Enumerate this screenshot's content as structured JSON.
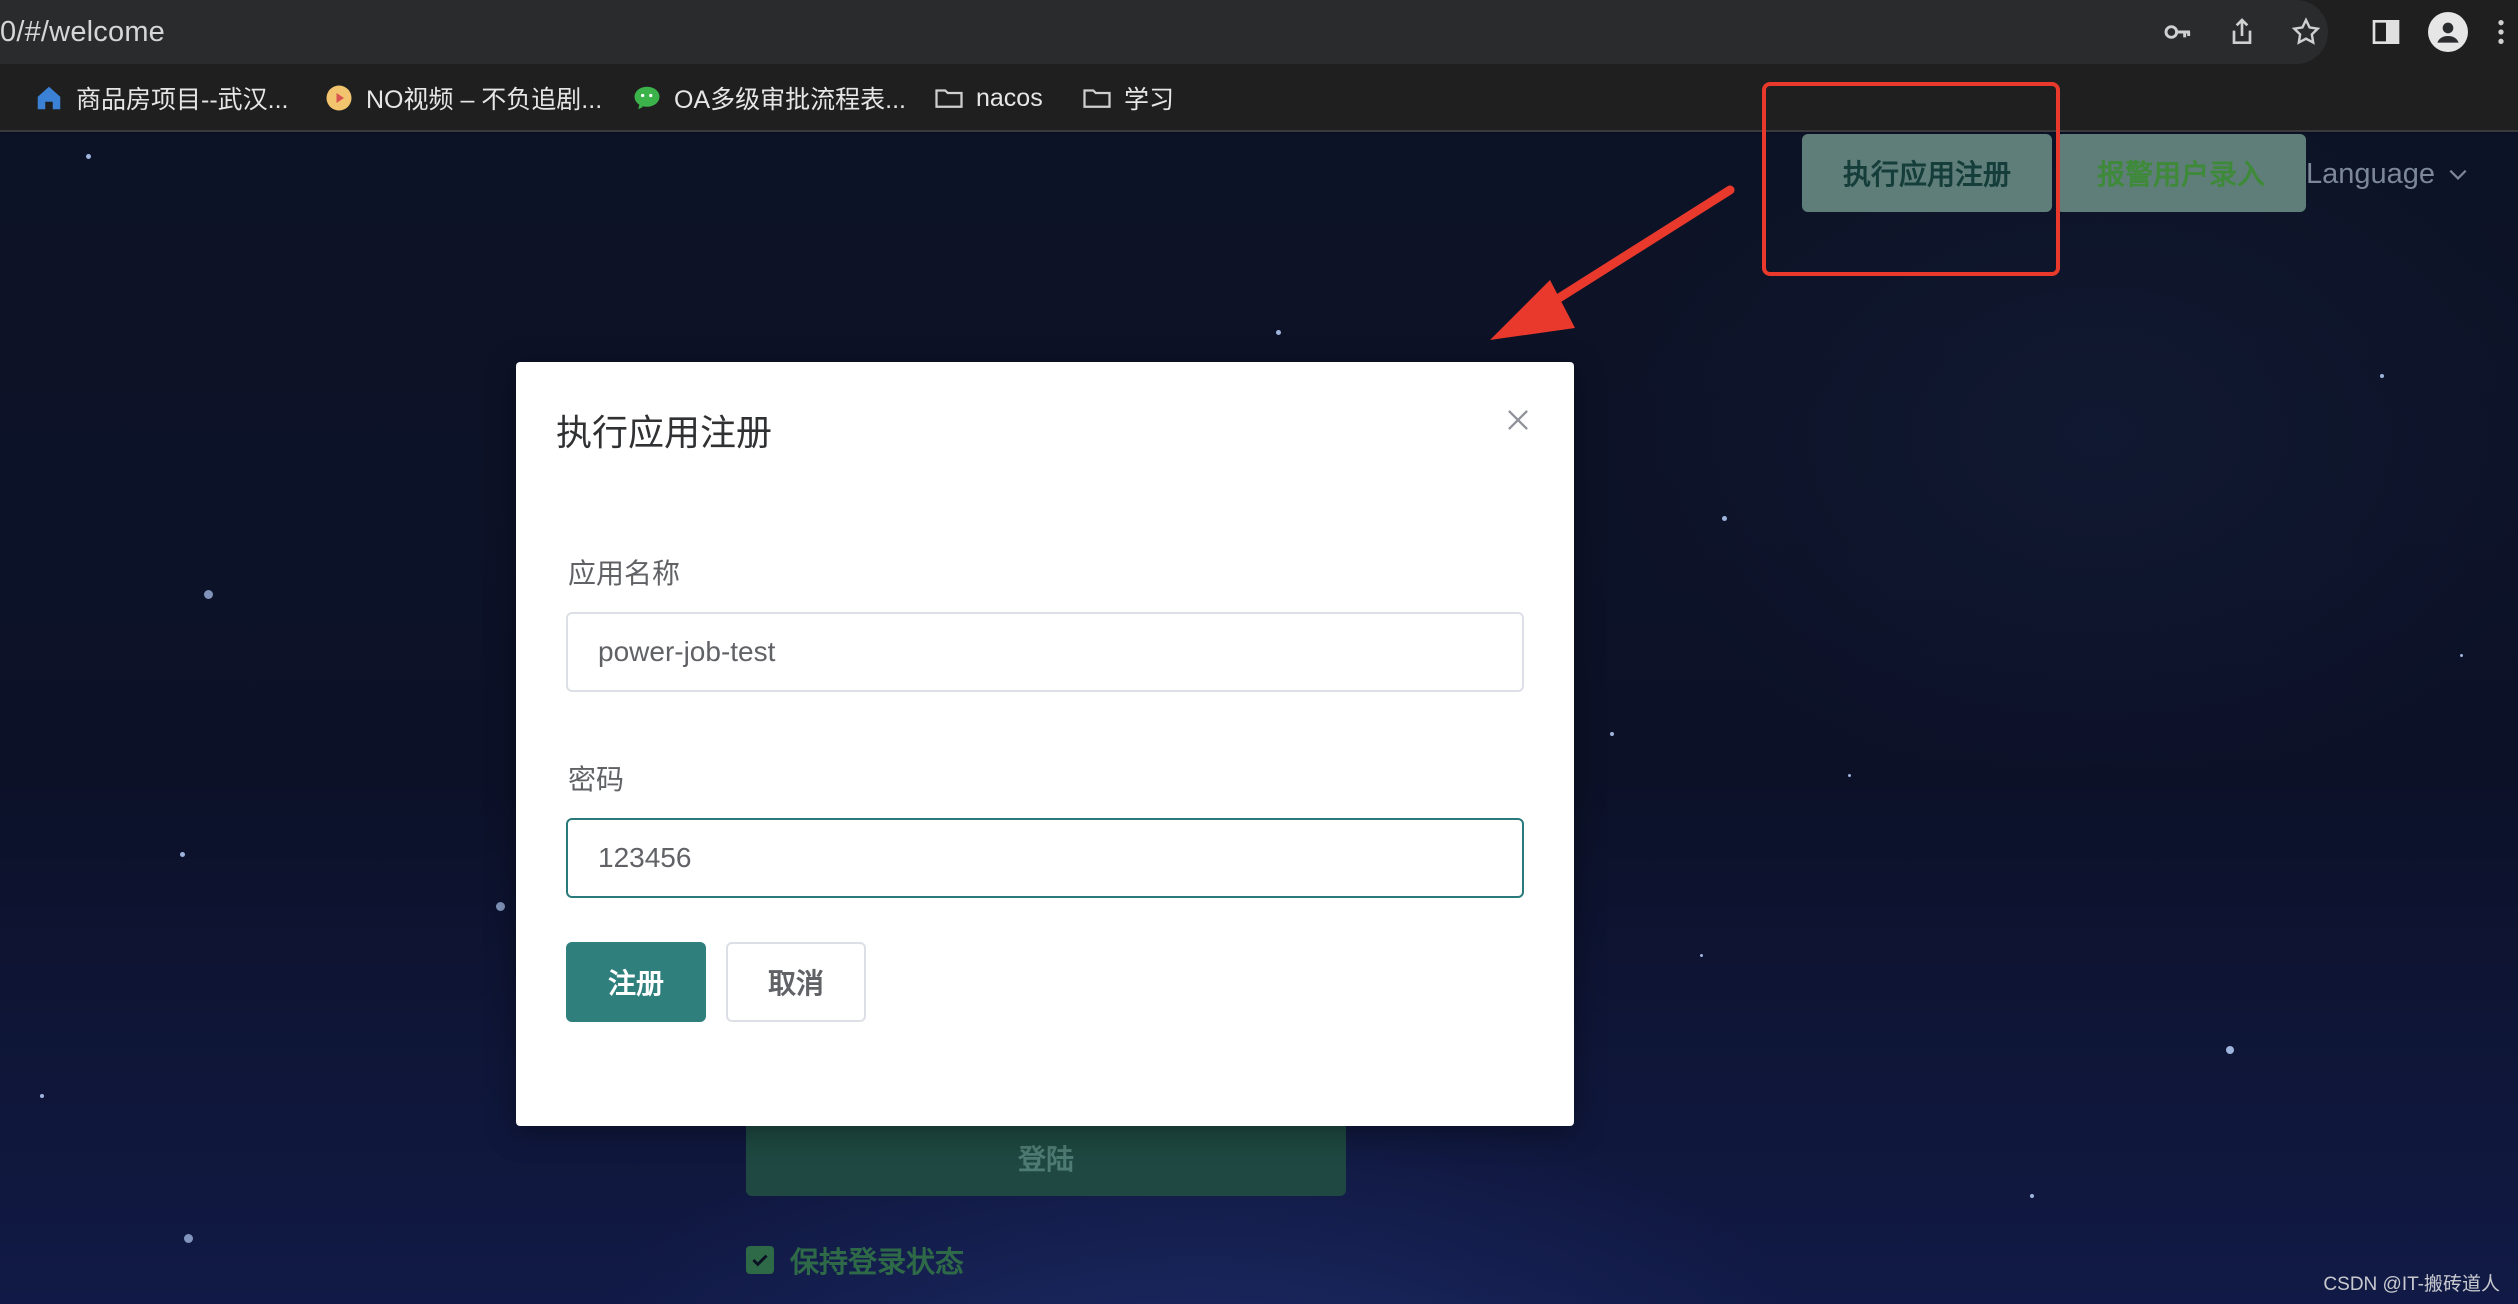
{
  "browser": {
    "url": "0/#/welcome",
    "bookmarks": [
      {
        "label": "商品房项目--武汉...",
        "icon": "home-icon"
      },
      {
        "label": "NO视频 – 不负追剧...",
        "icon": "play-icon"
      },
      {
        "label": "OA多级审批流程表...",
        "icon": "wechat-icon"
      },
      {
        "label": "nacos",
        "icon": "folder-icon"
      },
      {
        "label": "学习",
        "icon": "folder-icon"
      }
    ],
    "toolbar_icons": [
      "key-icon",
      "share-icon",
      "star-icon",
      "sidebar-icon",
      "profile-icon",
      "more-icon"
    ]
  },
  "header": {
    "register_app_label": "执行应用注册",
    "alarm_user_label": "报警用户录入",
    "language_label": "Language"
  },
  "modal": {
    "title": "执行应用注册",
    "app_name_label": "应用名称",
    "app_name_value": "power-job-test",
    "password_label": "密码",
    "password_value": "123456",
    "submit_label": "注册",
    "cancel_label": "取消"
  },
  "login": {
    "login_label": "登陆",
    "remember_label": "保持登录状态"
  },
  "watermark": "CSDN @IT-搬砖道人",
  "colors": {
    "accent": "#2f7f7d",
    "annotation_red": "#e8392c"
  }
}
